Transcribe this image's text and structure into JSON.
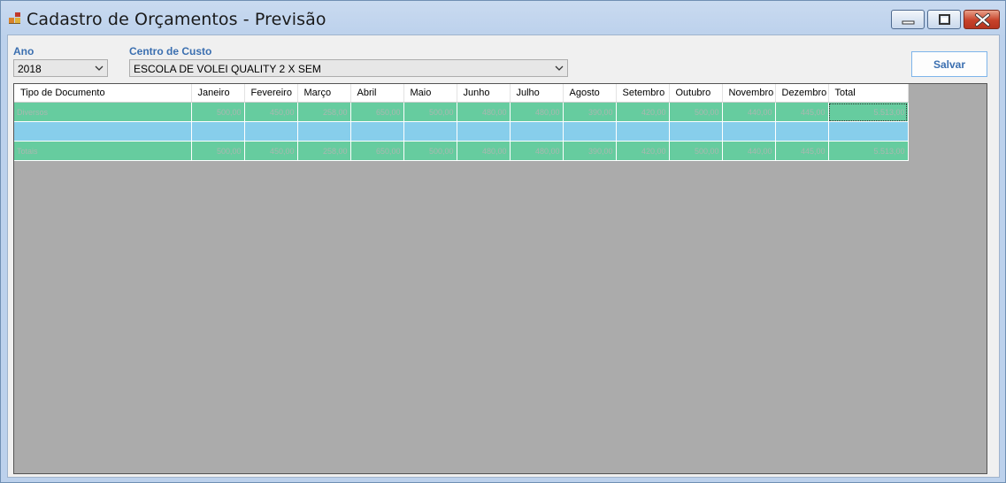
{
  "window": {
    "title": "Cadastro de Orçamentos - Previsão"
  },
  "form": {
    "ano_label": "Ano",
    "ano_value": "2018",
    "centro_label": "Centro de Custo",
    "centro_value": "ESCOLA DE VOLEI QUALITY 2 X SEM",
    "save_label": "Salvar"
  },
  "grid": {
    "columns": [
      "Tipo de Documento",
      "Janeiro",
      "Fevereiro",
      "Março",
      "Abril",
      "Maio",
      "Junho",
      "Julho",
      "Agosto",
      "Setembro",
      "Outubro",
      "Novembro",
      "Dezembro",
      "Total"
    ],
    "rows": [
      {
        "style": "green",
        "cells": [
          "Diversos",
          "500,00",
          "450,00",
          "258,00",
          "650,00",
          "500,00",
          "480,00",
          "480,00",
          "390,00",
          "420,00",
          "500,00",
          "440,00",
          "445,00",
          "5.513,00"
        ]
      },
      {
        "style": "blue",
        "cells": [
          "",
          "",
          "",
          "",
          "",
          "",
          "",
          "",
          "",
          "",
          "",
          "",
          "",
          ""
        ]
      },
      {
        "style": "green",
        "cells": [
          "Totais",
          "500,00",
          "450,00",
          "258,00",
          "650,00",
          "500,00",
          "480,00",
          "480,00",
          "390,00",
          "420,00",
          "500,00",
          "440,00",
          "445,00",
          "5.513,00"
        ]
      }
    ]
  },
  "colors": {
    "row_green": "#66cc9f",
    "row_blue": "#87ceeb",
    "grid_background": "#ababab",
    "label_blue": "#3b6fb0"
  },
  "icons": [
    "app-icon",
    "minimize-icon",
    "maximize-icon",
    "close-icon",
    "chevron-down-icon"
  ]
}
